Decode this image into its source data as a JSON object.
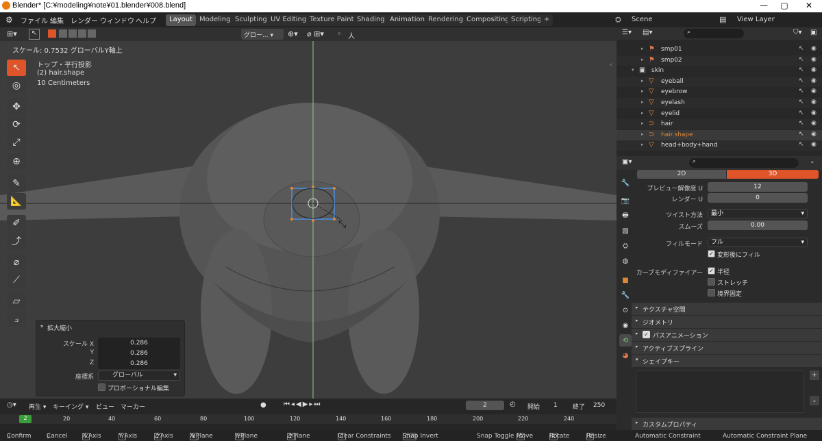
{
  "window": {
    "title": "Blender* [C:¥modeling¥note¥01.blender¥008.blend]"
  },
  "menu": [
    "ファイル",
    "編集",
    "レンダー",
    "ウィンドウ",
    "ヘルプ"
  ],
  "workspaces": [
    "Layout",
    "Modeling",
    "Sculpting",
    "UV Editing",
    "Texture Paint",
    "Shading",
    "Animation",
    "Rendering",
    "Compositing",
    "Scripting"
  ],
  "active_workspace": "Layout",
  "scene": {
    "name": "Scene",
    "view_layer": "View Layer"
  },
  "viewport": {
    "operator_hint": "スケール: 0.7532 グローバルY軸上",
    "view_name": "トップ・平行投影",
    "object": "(2) hair.shape",
    "unit": "10 Centimeters",
    "orientation": "グロー...",
    "pivot_label": "人"
  },
  "redo_panel": {
    "title": "拡大縮小",
    "scale_x_label": "スケール X",
    "y_label": "Y",
    "z_label": "Z",
    "scale_x": "0.286",
    "scale_y": "0.286",
    "scale_z": "0.286",
    "coord_label": "座標系",
    "coord_value": "グローバル",
    "proportional": "プロポーショナル編集"
  },
  "timeline": {
    "playback": "再生",
    "keying": "キーイング",
    "view": "ビュー",
    "marker": "マーカー",
    "current_frame": "2",
    "start_label": "開始",
    "start": "1",
    "end_label": "終了",
    "end": "250",
    "ruler": [
      "2",
      "20",
      "40",
      "60",
      "80",
      "100",
      "120",
      "140",
      "160",
      "180",
      "200",
      "220",
      "240"
    ]
  },
  "status": {
    "confirm": "Confirm",
    "cancel": "Cancel",
    "x_axis": "X Axis",
    "y_axis": "Y Axis",
    "z_axis": "Z Axis",
    "x_plane": "X Plane",
    "y_plane": "Y Plane",
    "z_plane": "Z Plane",
    "clear": "Clear Constraints",
    "snap_invert": "Snap Invert",
    "snap_toggle": "Snap Toggle",
    "move": "Move",
    "rotate": "Rotate",
    "resize": "Resize",
    "auto_constraint": "Automatic Constraint",
    "auto_constraint_plane": "Automatic Constraint Plane",
    "keys": {
      "x": "X",
      "y": "Y",
      "z": "Z",
      "clear": "C",
      "snap_invert": "Ctrl",
      "move": "G",
      "rotate": "R",
      "resize": "S"
    }
  },
  "outliner": {
    "items": [
      {
        "name": "smp01",
        "indent": 2,
        "icon": "armature-icon",
        "color": "#e07a4a"
      },
      {
        "name": "smp02",
        "indent": 2,
        "icon": "armature-icon",
        "color": "#e07a4a"
      },
      {
        "name": "skin",
        "indent": 1,
        "icon": "collection-icon",
        "color": "#cccccc"
      },
      {
        "name": "eyeball",
        "indent": 2,
        "icon": "mesh-icon",
        "color": "#e0883a"
      },
      {
        "name": "eyebrow",
        "indent": 2,
        "icon": "mesh-icon",
        "color": "#e0883a"
      },
      {
        "name": "eyelash",
        "indent": 2,
        "icon": "mesh-icon",
        "color": "#e0883a"
      },
      {
        "name": "eyelid",
        "indent": 2,
        "icon": "mesh-icon",
        "color": "#e0883a"
      },
      {
        "name": "hair",
        "indent": 2,
        "icon": "curve-icon",
        "color": "#e0883a"
      },
      {
        "name": "hair.shape",
        "indent": 2,
        "icon": "curve-icon",
        "color": "#e0883a",
        "active": true
      },
      {
        "name": "head+body+hand",
        "indent": 2,
        "icon": "mesh-icon",
        "color": "#e0883a"
      }
    ]
  },
  "properties": {
    "tab_2d": "2D",
    "tab_3d": "3D",
    "preview_res_label": "プレビュー解像度 U",
    "preview_res": "12",
    "render_label": "レンダー U",
    "render": "0",
    "twist_label": "ツイスト方法",
    "twist": "最小",
    "smooth_label": "スムーズ",
    "smooth": "0.00",
    "fill_label": "フィルモード",
    "fill": "フル",
    "fill_deform": "変形後にフィル",
    "curve_mod_label": "カーブモディファイアー",
    "radius": "半径",
    "stretch": "ストレッチ",
    "bounds": "境界固定",
    "panels": [
      "テクスチャ空間",
      "ジオメトリ",
      "パスアニメーション",
      "アクティブスプライン",
      "シェイプキー"
    ],
    "custom_props": "カスタムプロパティ"
  },
  "colors": {
    "accent": "#e0542a",
    "selection": "#4a8fe0",
    "green_axis": "#7dd87d"
  }
}
